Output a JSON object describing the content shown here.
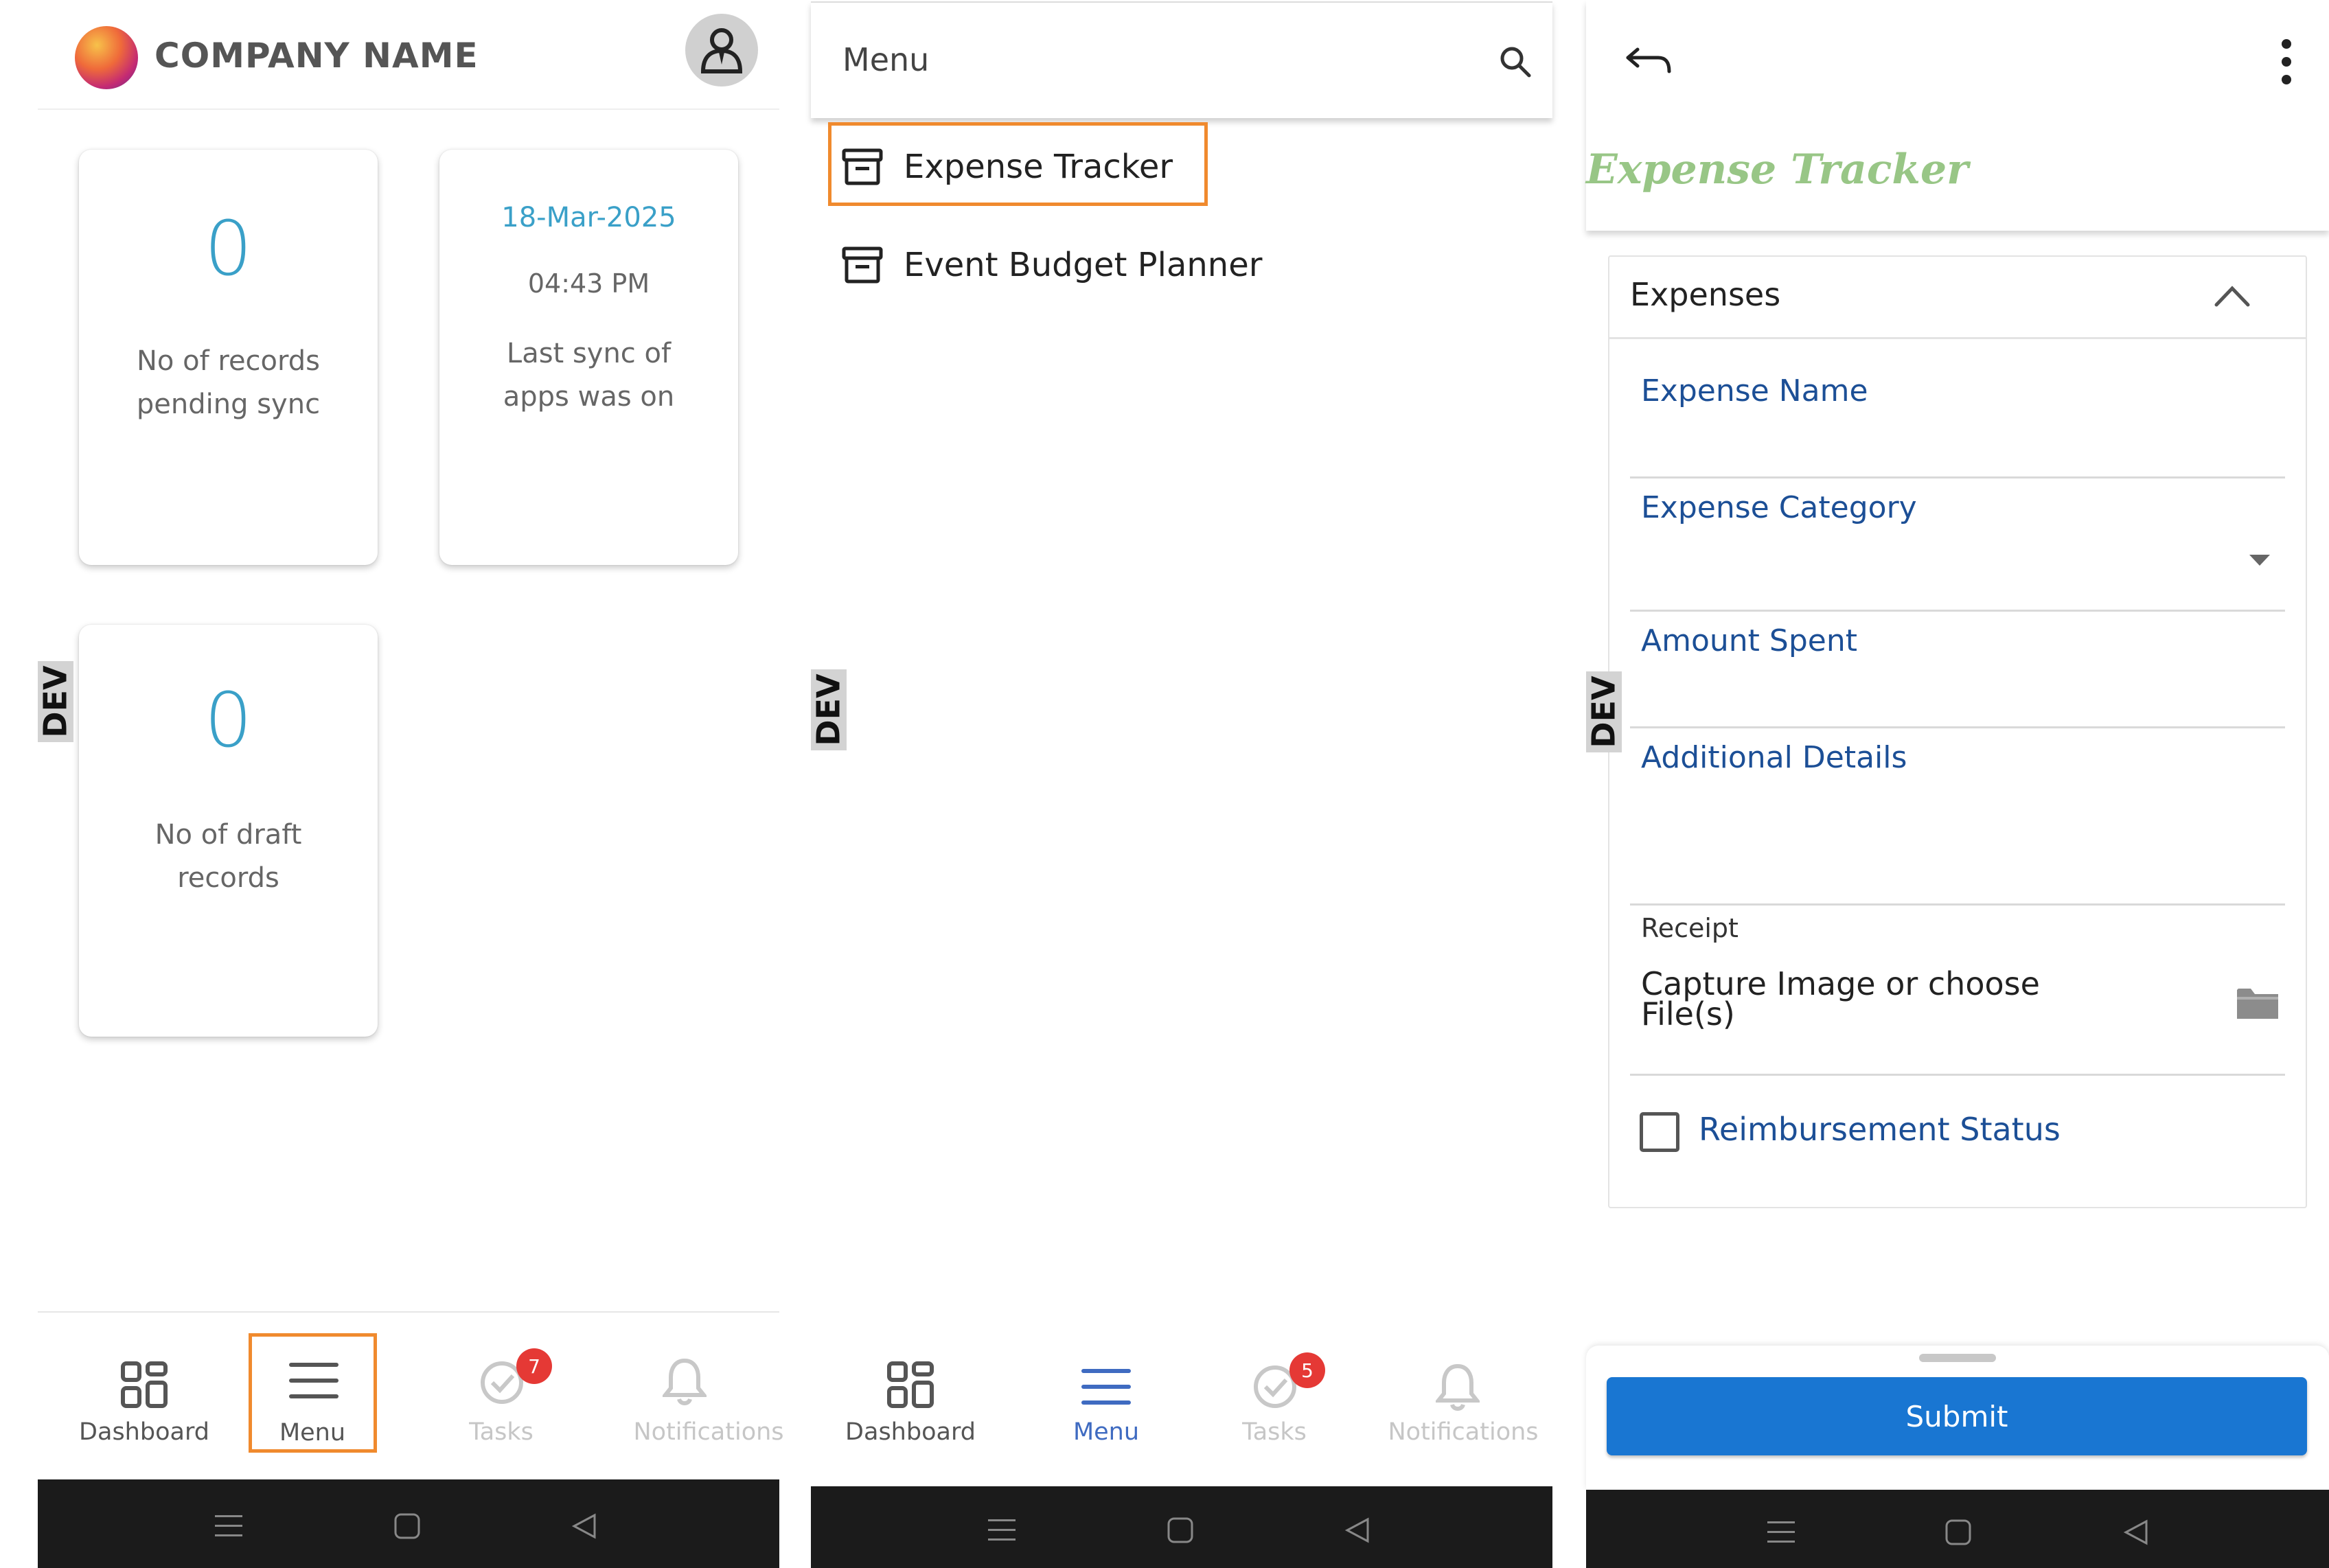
{
  "panel1": {
    "company_name": "COMPANY NAME",
    "cards": {
      "pending_count": "0",
      "pending_label_1": "No of records",
      "pending_label_2": "pending sync",
      "sync_date": "18-Mar-2025",
      "sync_time": "04:43 PM",
      "sync_label_1": "Last sync of",
      "sync_label_2": "apps was on",
      "draft_count": "0",
      "draft_label_1": "No of draft",
      "draft_label_2": "records"
    },
    "dev_tag": "DEV",
    "nav": {
      "dashboard": "Dashboard",
      "menu": "Menu",
      "tasks": "Tasks",
      "tasks_badge": "7",
      "notifications": "Notifications"
    }
  },
  "panel2": {
    "title": "Menu",
    "items": [
      "Expense Tracker",
      "Event Budget Planner"
    ],
    "dev_tag": "DEV",
    "nav": {
      "dashboard": "Dashboard",
      "menu": "Menu",
      "tasks": "Tasks",
      "tasks_badge": "5",
      "notifications": "Notifications"
    }
  },
  "panel3": {
    "title": "Expense Tracker",
    "section": "Expenses",
    "fields": {
      "expense_name": "Expense Name",
      "expense_category": "Expense Category",
      "amount_spent": "Amount Spent",
      "additional_details": "Additional Details",
      "receipt": "Receipt",
      "receipt_placeholder_1": "Capture Image or choose",
      "receipt_placeholder_2": "File(s)",
      "reimbursement_status": "Reimbursement Status"
    },
    "dev_tag": "DEV",
    "submit": "Submit"
  },
  "colors": {
    "accent_blue": "#3aa0c8",
    "label_blue": "#1c4f96",
    "nav_active": "#3f6bc1",
    "highlight_orange": "#f08a2e",
    "submit_blue": "#1976d2",
    "title_green": "#98c686"
  }
}
